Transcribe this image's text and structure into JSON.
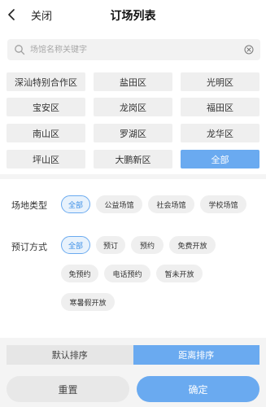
{
  "header": {
    "back_label": "关闭",
    "title": "订场列表"
  },
  "search": {
    "placeholder": "场馆名称关键字",
    "value": ""
  },
  "districts": [
    {
      "label": "深汕特别合作区",
      "active": false
    },
    {
      "label": "盐田区",
      "active": false
    },
    {
      "label": "光明区",
      "active": false
    },
    {
      "label": "宝安区",
      "active": false
    },
    {
      "label": "龙岗区",
      "active": false
    },
    {
      "label": "福田区",
      "active": false
    },
    {
      "label": "南山区",
      "active": false
    },
    {
      "label": "罗湖区",
      "active": false
    },
    {
      "label": "龙华区",
      "active": false
    },
    {
      "label": "坪山区",
      "active": false
    },
    {
      "label": "大鹏新区",
      "active": false
    },
    {
      "label": "全部",
      "active": true
    }
  ],
  "venue_type": {
    "label": "场地类型",
    "options": [
      {
        "label": "全部",
        "active": true
      },
      {
        "label": "公益场馆",
        "active": false
      },
      {
        "label": "社会场馆",
        "active": false
      },
      {
        "label": "学校场馆",
        "active": false
      }
    ]
  },
  "booking_method": {
    "label": "预订方式",
    "options": [
      {
        "label": "全部",
        "active": true
      },
      {
        "label": "预订",
        "active": false
      },
      {
        "label": "预约",
        "active": false
      },
      {
        "label": "免费开放",
        "active": false
      },
      {
        "label": "免预约",
        "active": false
      },
      {
        "label": "电话预约",
        "active": false
      },
      {
        "label": "暂未开放",
        "active": false
      },
      {
        "label": "寒暑假开放",
        "active": false
      }
    ]
  },
  "sort": {
    "options": [
      {
        "label": "默认排序",
        "active": false
      },
      {
        "label": "距离排序",
        "active": true
      }
    ]
  },
  "actions": {
    "reset_label": "重置",
    "confirm_label": "确定"
  },
  "colors": {
    "accent": "#6aaaf0",
    "chip_bg": "#efefef",
    "page_bg": "#f4f4f4"
  }
}
